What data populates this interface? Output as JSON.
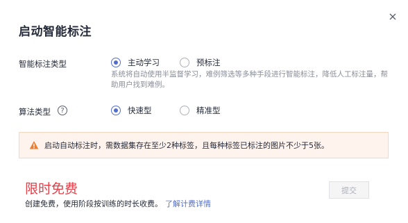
{
  "dialog": {
    "title": "启动智能标注",
    "close_icon": "close-icon"
  },
  "label_type": {
    "label": "智能标注类型",
    "options": [
      {
        "label": "主动学习",
        "checked": true
      },
      {
        "label": "预标注",
        "checked": false
      }
    ],
    "hint": "系统将自动使用半监督学习，难例筛选等多种手段进行智能标注，降低人工标注量，帮助用户找到难例。"
  },
  "algorithm": {
    "label": "算法类型",
    "help_icon": "question-circle-icon",
    "help_glyph": "?",
    "options": [
      {
        "label": "快速型",
        "checked": true
      },
      {
        "label": "精准型",
        "checked": false
      }
    ]
  },
  "warning": {
    "icon": "warning-triangle-icon",
    "text": "启动自动标注时，需数据集存在至少2种标签，且每种标签已标注的图片不少于5张。",
    "color": "#fff4ed"
  },
  "footer": {
    "price": "限时免费",
    "price_color": "#e5404a",
    "desc": "创建免费，使用阶段按训练的时长收费。",
    "link": "了解计费详情",
    "submit_label": "提交"
  }
}
